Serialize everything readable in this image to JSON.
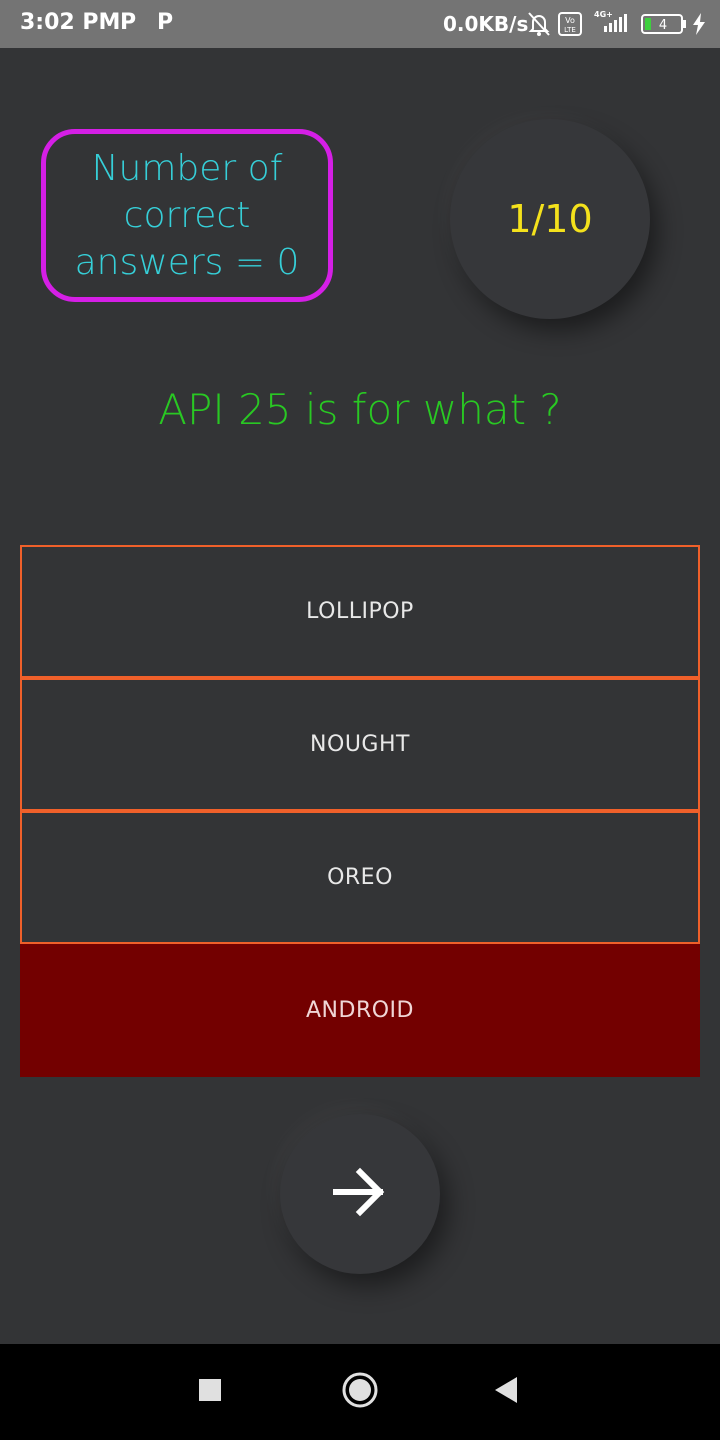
{
  "status_bar": {
    "time": "3:02 PM",
    "notification_icons": [
      "P",
      "P"
    ],
    "network_speed": "0.0KB/s",
    "network_type": "4G+",
    "volte_label": "Vo\nLTE",
    "battery_level": "4",
    "icons": [
      "parking-app-icon",
      "parking-app-icon",
      "mute-bell-icon",
      "volte-icon",
      "signal-icon",
      "battery-icon",
      "charging-icon"
    ]
  },
  "quiz": {
    "score_text": "Number of correct answers = 0",
    "progress": "1/10",
    "question": "API 25 is for what ?",
    "options": [
      "LOLLIPOP",
      "NOUGHT",
      "OREO",
      "ANDROID"
    ],
    "selected_option": "ANDROID",
    "next_icon": "arrow-right-icon"
  },
  "colors": {
    "background": "#333436",
    "score_border": "#d51fe6",
    "score_text": "#36cfd8",
    "progress_text": "#f4e11c",
    "question_text": "#29c823",
    "option_border": "#f0602a",
    "selected_bg": "#730000"
  },
  "nav_bar": {
    "icons": [
      "recents-square-icon",
      "home-circle-icon",
      "back-triangle-icon"
    ]
  }
}
